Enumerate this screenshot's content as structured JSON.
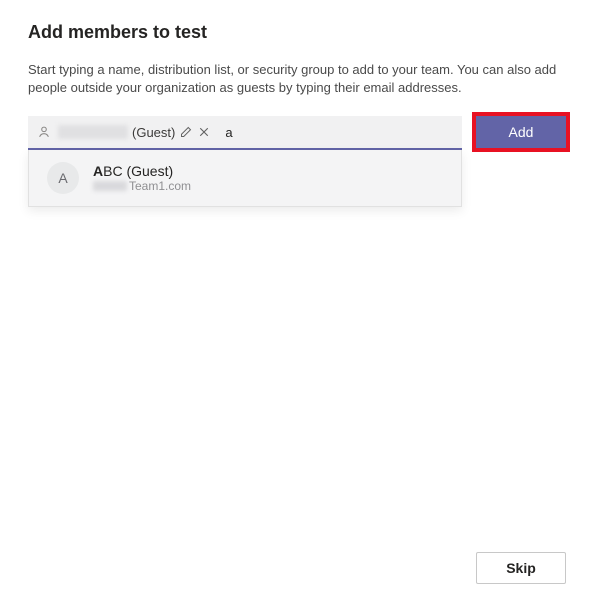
{
  "dialog": {
    "title": "Add members to test",
    "subtitle": "Start typing a name, distribution list, or security group to add to your team. You can also add people outside your organization as guests by typing their email addresses."
  },
  "input": {
    "chip_suffix": "(Guest)",
    "typed_value": "a"
  },
  "buttons": {
    "add": "Add",
    "skip": "Skip"
  },
  "suggestion": {
    "avatar_letter": "A",
    "name_bold": "A",
    "name_rest": "BC (Guest)",
    "email_domain": "Team1.com"
  }
}
